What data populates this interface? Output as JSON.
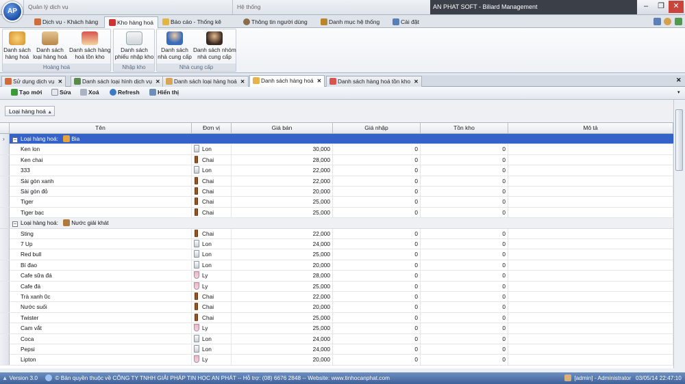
{
  "window": {
    "context_groups": [
      "Quản lý dịch vụ",
      "Hệ thống"
    ],
    "title": "AN PHAT SOFT - Biliard Management",
    "minimize": "–",
    "restore": "❐",
    "close": "✕"
  },
  "logo_text": "AP",
  "ribbon_tabs": [
    {
      "label": "Dịch vụ - Khách hàng",
      "icon": "service-icon"
    },
    {
      "label": "Kho hàng hoá",
      "icon": "warehouse-icon"
    },
    {
      "label": "Báo cáo - Thống kê",
      "icon": "report-icon"
    },
    {
      "label": "Thông tin người dùng",
      "icon": "user-info-icon"
    },
    {
      "label": "Danh mục hệ thống",
      "icon": "catalog-icon"
    },
    {
      "label": "Cài đặt",
      "icon": "settings-icon"
    }
  ],
  "ribbon_groups": [
    {
      "label": "Hoàng hoá",
      "buttons": [
        "Danh sách\nhàng hoá",
        "Danh sách\nloại hàng hoá",
        "Danh sách hàng\nhoá tồn kho"
      ]
    },
    {
      "label": "Nhập kho",
      "buttons": [
        "Danh sách\nphiếu nhập kho"
      ]
    },
    {
      "label": "Nhà cung cấp",
      "buttons": [
        "Danh sách\nnhà cung cấp",
        "Danh sách nhóm\nnhà cung cấp"
      ]
    }
  ],
  "doc_tabs": [
    {
      "label": "Sử dụng dịch vụ",
      "active": false
    },
    {
      "label": "Danh sách loại hình dịch vụ",
      "active": false
    },
    {
      "label": "Danh sách loại hàng hoá",
      "active": false
    },
    {
      "label": "Danh sách hàng hoá",
      "active": true
    },
    {
      "label": "Danh sách hàng hoá tồn kho",
      "active": false
    }
  ],
  "doc_close": "✕",
  "toolbar": {
    "new": "Tạo mới",
    "edit": "Sửa",
    "delete": "Xoá",
    "refresh": "Refresh",
    "show": "Hiển thị"
  },
  "group_chip": "Loại hàng hoá",
  "columns": [
    "Tên",
    "Đơn vị",
    "Giá bán",
    "Giá nhập",
    "Tồn kho",
    "Mô tả"
  ],
  "groups": [
    {
      "label": "Loại hàng hoá:",
      "name": "Bia",
      "selected": true,
      "rows": [
        [
          "Ken lon",
          "Lon",
          "30,000",
          "0",
          "0"
        ],
        [
          "Ken chai",
          "Chai",
          "28,000",
          "0",
          "0"
        ],
        [
          "333",
          "Lon",
          "22,000",
          "0",
          "0"
        ],
        [
          "Sài gòn xanh",
          "Chai",
          "22,000",
          "0",
          "0"
        ],
        [
          "Sài gòn đỏ",
          "Chai",
          "20,000",
          "0",
          "0"
        ],
        [
          "Tiger",
          "Chai",
          "25,000",
          "0",
          "0"
        ],
        [
          "Tiger bạc",
          "Chai",
          "25,000",
          "0",
          "0"
        ]
      ]
    },
    {
      "label": "Loại hàng hoá:",
      "name": "Nước giải khát",
      "selected": false,
      "rows": [
        [
          "Sting",
          "Chai",
          "22,000",
          "0",
          "0"
        ],
        [
          "7 Up",
          "Lon",
          "24,000",
          "0",
          "0"
        ],
        [
          "Red bull",
          "Lon",
          "25,000",
          "0",
          "0"
        ],
        [
          "Bí đao",
          "Lon",
          "20,000",
          "0",
          "0"
        ],
        [
          "Cafe sữa đá",
          "Ly",
          "28,000",
          "0",
          "0"
        ],
        [
          "Cafe đá",
          "Ly",
          "25,000",
          "0",
          "0"
        ],
        [
          "Trà xanh 0c",
          "Chai",
          "22,000",
          "0",
          "0"
        ],
        [
          "Nước suối",
          "Chai",
          "20,000",
          "0",
          "0"
        ],
        [
          "Twister",
          "Chai",
          "25,000",
          "0",
          "0"
        ],
        [
          "Cam vắt",
          "Ly",
          "25,000",
          "0",
          "0"
        ],
        [
          "Coca",
          "Lon",
          "24,000",
          "0",
          "0"
        ],
        [
          "Pepsi",
          "Lon",
          "24,000",
          "0",
          "0"
        ],
        [
          "Lipton",
          "Ly",
          "20,000",
          "0",
          "0"
        ]
      ]
    }
  ],
  "status": {
    "version": "Version 3.0",
    "copyright": "© Bản quyền thuộc về CÔNG TY TNHH GIẢI PHÁP TIN HỌC AN PHÁT  --  Hỗ trợ: (08) 6676 2848  --  Website: www.tinhocanphat.com",
    "user": "[admin] - Administrator",
    "datetime": "03/05/14 22:47:10"
  },
  "colors": {
    "selection": "#3462c9",
    "statusbar": "#4f73aa"
  }
}
